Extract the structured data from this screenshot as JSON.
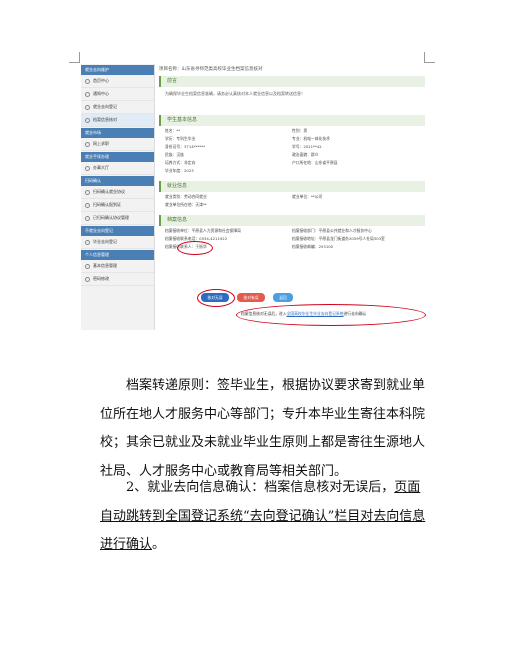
{
  "screenshot": {
    "sidebar": {
      "sections": [
        {
          "title": "就业去向维护",
          "items": [
            "首页中心",
            "通知中心",
            "就业去向登记",
            "档案信息核对"
          ]
        },
        {
          "title": "就业市场",
          "items": [
            "网上求职"
          ]
        },
        {
          "title": "就业手续办理",
          "items": [
            "办事大厅"
          ]
        },
        {
          "title": "扫码确认",
          "items": [
            "扫码确认就业协议",
            "扫码确认报到证",
            "已扫码确认协议管理"
          ]
        },
        {
          "title": "不就业去向登记",
          "items": [
            "毕业去向登记"
          ]
        },
        {
          "title": "个人信息管理",
          "items": [
            "基本信息管理",
            "密码修改"
          ]
        }
      ],
      "active_item": "档案信息核对"
    },
    "project_name": "项目名称：山东省寻师范类高校毕业生档案信息核对",
    "preface": {
      "title": "前言",
      "text": "为确保毕业生档案信息准确，请务必认真核对本人就业信息以及档案转送信息！"
    },
    "basic_info": {
      "title": "学生基本信息",
      "fields": [
        "姓名：**",
        "性别：男",
        "学历：专科生毕业",
        "专业：机电一体化技术",
        "身份证号：3714******",
        "学号：2021**42",
        "民族：汉族",
        "政治面貌：群众",
        "培养方式：非定向",
        "户口所在地：山东省平原县",
        "毕业年度：2023",
        ""
      ]
    },
    "employment_info": {
      "title": "就业信息",
      "fields": [
        "就业类别：劳动合同就业",
        "就业单位：**公司",
        "就业单位所在地：天津**",
        ""
      ]
    },
    "archive_info": {
      "title": "档案信息",
      "fields": [
        "档案接收单位：平原县人力资源和社会保障局",
        "档案接收部门：平原县公共就业和人才服务中心",
        "档案接收联系电话：0534-4211922",
        "档案接收地址：平原县龙门街道办2059号人社局303室",
        "档案接收联系人：于振华",
        "档案接收邮编：253100"
      ]
    },
    "buttons": {
      "confirm": "核对无误",
      "error": "核对有误",
      "back": "返回"
    },
    "notice": {
      "pre": "档案信息核对无误后，进入",
      "link": "全国高校毕业生毕业去向登记系统",
      "post": "进行去向确认"
    }
  },
  "document": {
    "para1": "档案转递原则：签毕业生，根据协议要求寄到就业单位所在地人才服务中心等部门；专升本毕业生寄往本科院校；其余已就业及未就业毕业生原则上都是寄往生源地人社局、人才服务中心或教育局等相关部门。",
    "para2_pre": "2、就业去向信息确认：档案信息核对无误后，",
    "para2_ul1": "页面自动跳转到全国登记系统“去向登记确认”栏目对去向信息进行确认",
    "para2_post": "。"
  }
}
